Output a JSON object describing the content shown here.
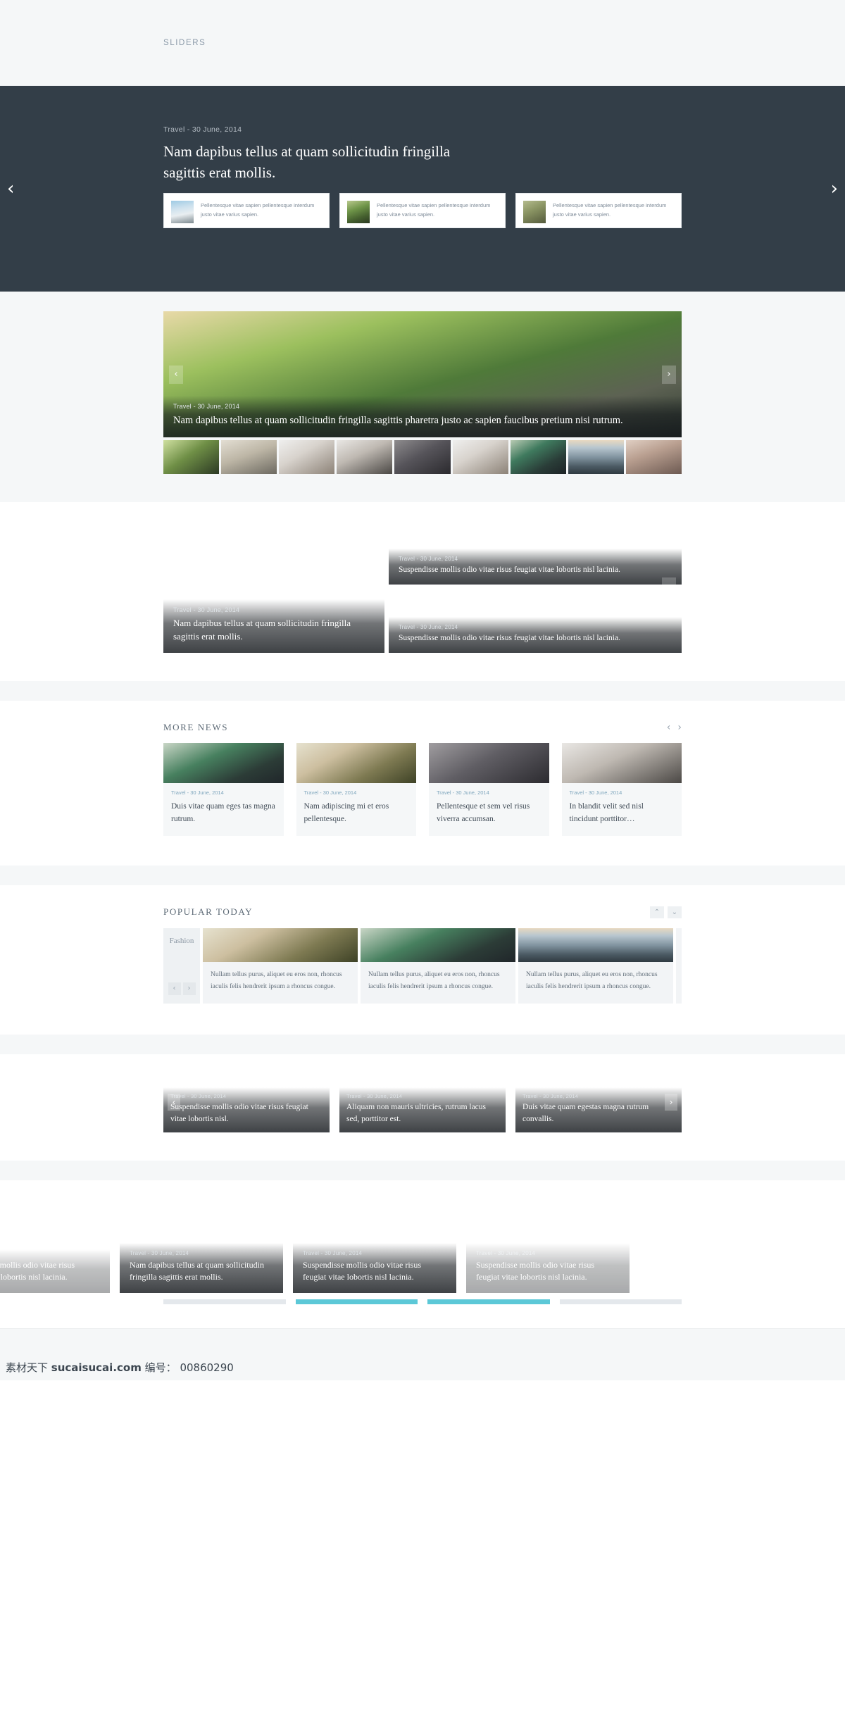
{
  "breadcrumb": "SLIDERS",
  "hero": {
    "kicker": "Travel - 30 June, 2014",
    "title": "Nam dapibus tellus at quam sollicitudin fringilla sagittis erat mollis.",
    "prev_icon": "‹",
    "next_icon": "›",
    "cards": [
      {
        "text": "Pellentesque vitae sapien pellentesque interdum justo vitae varius sapien.",
        "image": "ph-snow"
      },
      {
        "text": "Pellentesque vitae sapien pellentesque interdum justo vitae varius sapien.",
        "image": "ph-fence2"
      },
      {
        "text": "Pellentesque vitae sapien pellentesque interdum justo vitae varius sapien.",
        "image": "ph-chair"
      }
    ]
  },
  "slider2": {
    "meta": "Travel - 30 June, 2014",
    "title": "Nam dapibus tellus at quam sollicitudin fringilla sagittis pharetra justo ac sapien faucibus pretium nisi rutrum.",
    "prev_icon": "‹",
    "next_icon": "›",
    "thumbs": [
      "ph-bike",
      "ph-cannon",
      "ph-hand",
      "ph-watch",
      "ph-camera",
      "ph-hand",
      "ph-plant",
      "ph-pier",
      "ph-woman"
    ]
  },
  "mosaic": {
    "prev_icon": "‹",
    "next_icon": "›",
    "main": {
      "meta": "Travel - 30 June, 2014",
      "title": "Nam dapibus tellus at quam sollicitudin fringilla sagittis erat mollis.",
      "image": "ph-ferris"
    },
    "side": [
      {
        "meta": "Travel - 30 June, 2014",
        "title": "Suspendisse mollis odio vitae risus feugiat vitae lobortis nisl lacinia.",
        "image": "ph-guitar"
      },
      {
        "meta": "Travel - 30 June, 2014",
        "title": "Suspendisse mollis odio vitae risus feugiat vitae lobortis nisl lacinia.",
        "image": "ph-plant"
      }
    ]
  },
  "more_news": {
    "title": "MORE NEWS",
    "prev_icon": "‹",
    "next_icon": "›",
    "cards": [
      {
        "meta": "Travel - 30 June, 2014",
        "title": "Duis vitae quam eges tas magna rutrum.",
        "image": "ph-plant2"
      },
      {
        "meta": "Travel - 30 June, 2014",
        "title": "Nam adipiscing mi et eros pellentesque.",
        "image": "ph-kite"
      },
      {
        "meta": "Travel - 30 June, 2014",
        "title": "Pellentesque et sem vel risus viverra accumsan.",
        "image": "ph-bag"
      },
      {
        "meta": "Travel - 30 June, 2014",
        "title": "In blandit velit sed nisl tincidunt porttitor…",
        "image": "ph-watch"
      }
    ]
  },
  "popular_today": {
    "title": "POPULAR TODAY",
    "up_icon": "⌃",
    "down_icon": "⌄",
    "category": "Fashion",
    "prev_icon": "‹",
    "next_icon": "›",
    "cards": [
      {
        "text": "Nullam tellus purus, aliquet eu eros non, rhoncus iaculis felis hendrerit ipsum a rhoncus congue.",
        "image": "ph-kite"
      },
      {
        "text": "Nullam tellus purus, aliquet eu eros non, rhoncus iaculis felis hendrerit ipsum a rhoncus congue.",
        "image": "ph-plant2"
      },
      {
        "text": "Nullam tellus purus, aliquet eu eros non, rhoncus iaculis felis hendrerit ipsum a rhoncus congue.",
        "image": "ph-pier"
      }
    ]
  },
  "trio": {
    "prev_icon": "‹",
    "next_icon": "›",
    "cards": [
      {
        "meta": "Travel - 30 June, 2014",
        "title": "Suspendisse mollis odio vitae risus feugiat vitae lobortis nisl.",
        "image": "ph-hat"
      },
      {
        "meta": "Travel - 30 June, 2014",
        "title": "Aliquam non mauris ultricies, rutrum lacus sed, porttitor est.",
        "image": "ph-guitar2"
      },
      {
        "meta": "Travel - 30 June, 2014",
        "title": "Duis vitae quam egestas magna rutrum convallis.",
        "image": "ph-pier2"
      }
    ]
  },
  "bleed_carousel": {
    "cards": [
      {
        "meta": "",
        "title": "Suspendisse mollis odio vitae risus feugiat vitae lobortis nisl lacinia.",
        "image": "ph-pier",
        "faded": true
      },
      {
        "meta": "Travel - 30 June, 2014",
        "title": "Nam dapibus tellus at quam sollicitudin fringilla sagittis erat mollis.",
        "image": "ph-ferris",
        "faded": false
      },
      {
        "meta": "Travel - 30 June, 2014",
        "title": "Suspendisse mollis odio vitae risus feugiat vitae lobortis nisl lacinia.",
        "image": "ph-fencebig",
        "faded": false
      },
      {
        "meta": "Travel - 30 June, 2014",
        "title": "Suspendisse mollis odio vitae risus feugiat vitae lobortis nisl lacinia.",
        "image": "ph-plant2",
        "faded": true
      }
    ],
    "progress": [
      {
        "active": false
      },
      {
        "active": true
      },
      {
        "active": true
      },
      {
        "active": false
      }
    ],
    "accent_color": "#5cc8d7"
  },
  "watermark": {
    "cn_prefix": "素材天下",
    "site": "sucaisucai.com",
    "id_label": "编号：",
    "id_value": "00860290"
  }
}
